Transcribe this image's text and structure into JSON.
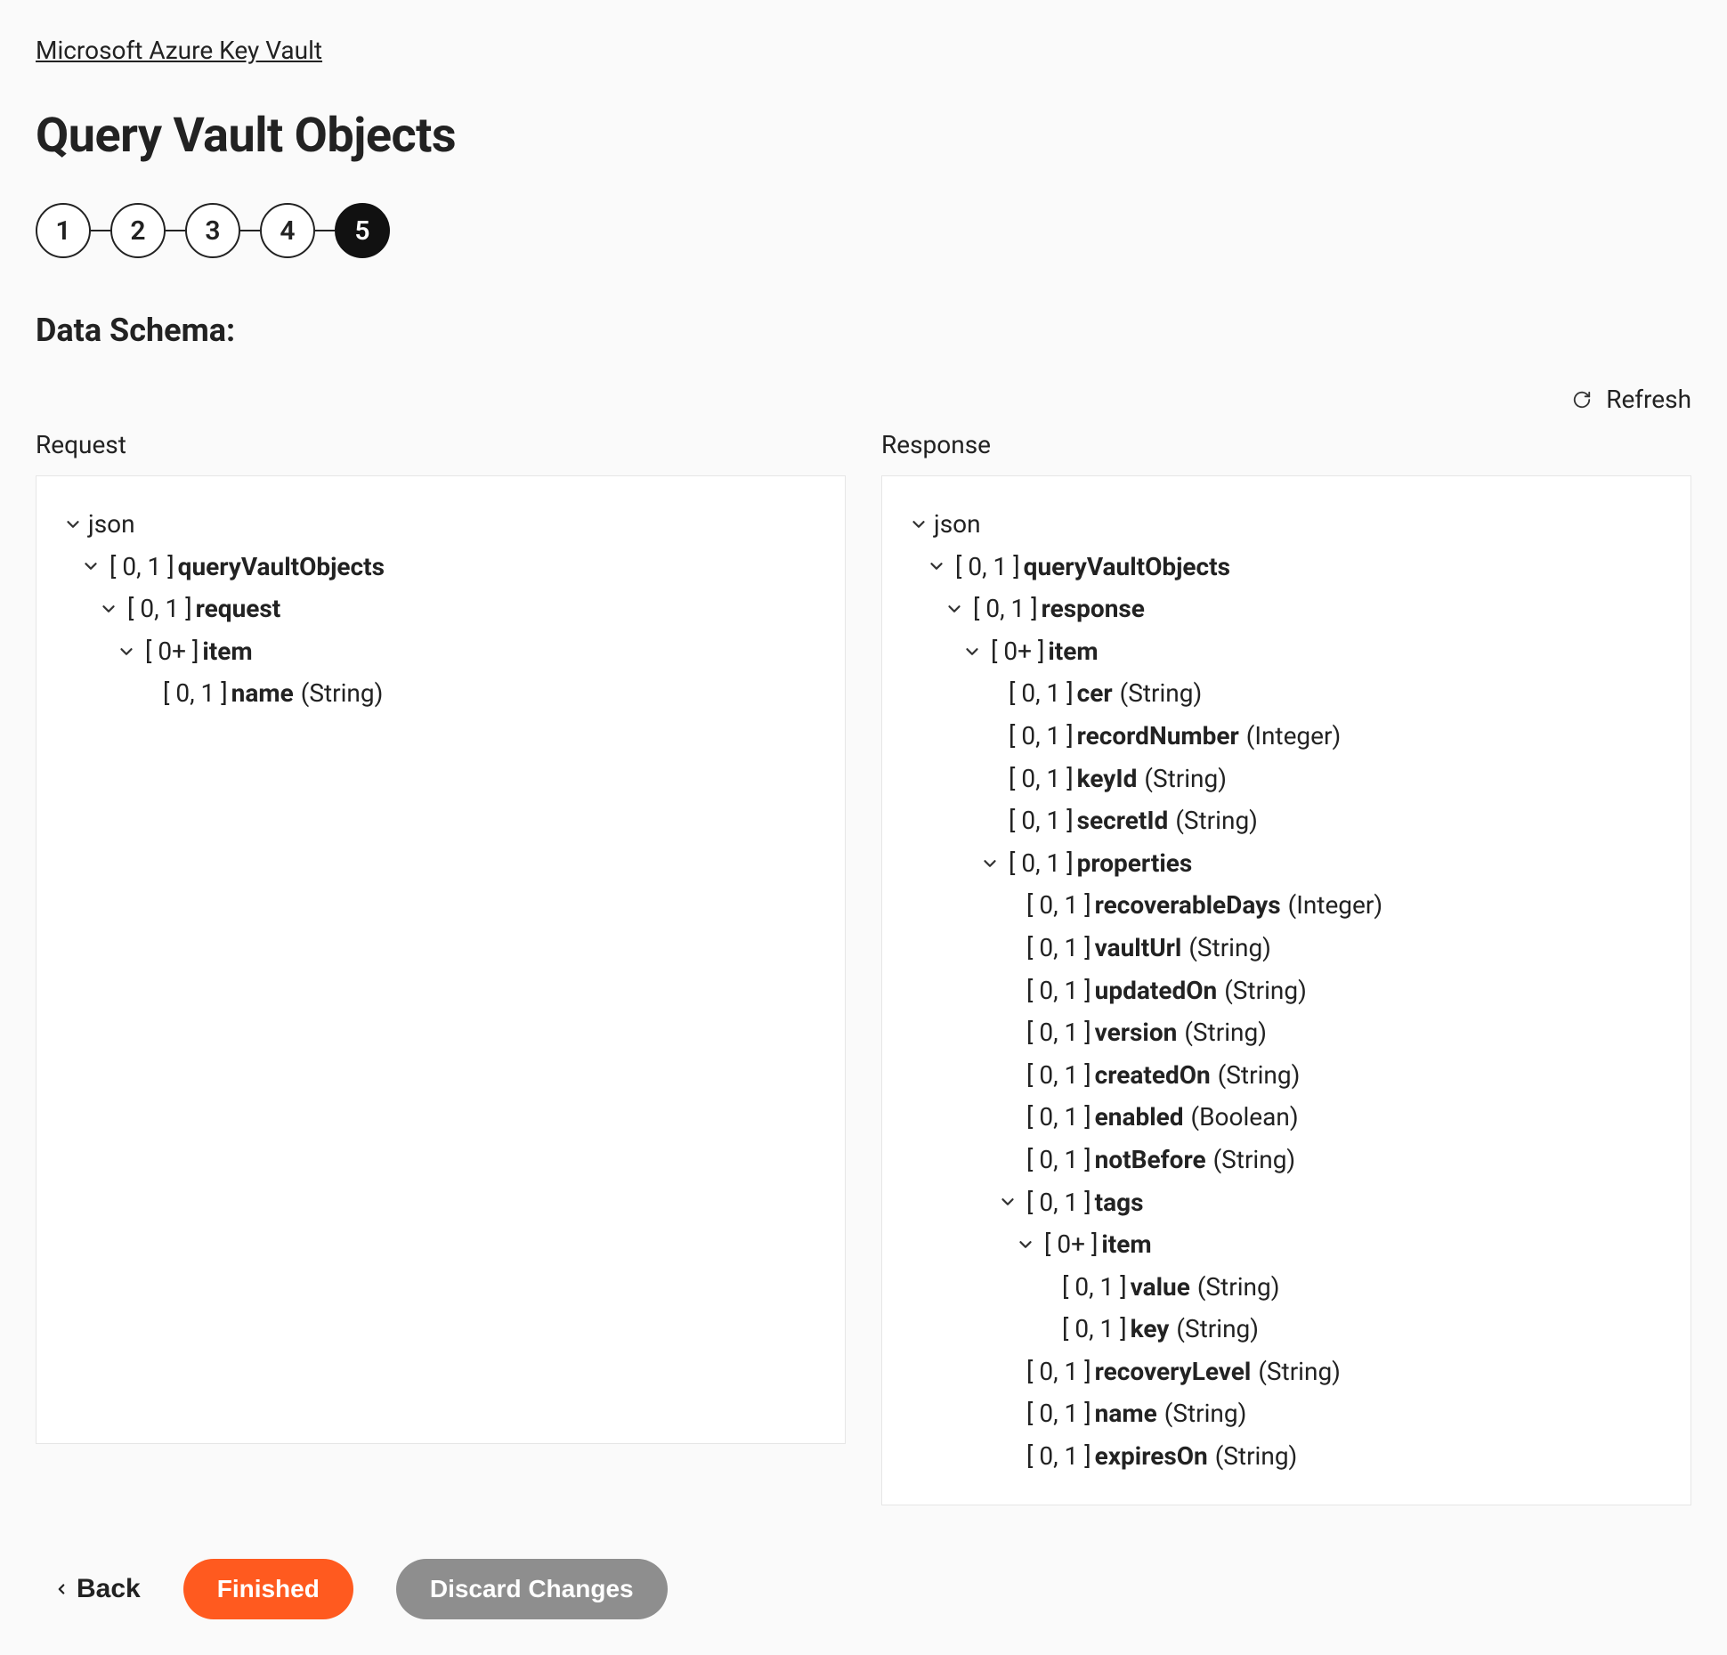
{
  "breadcrumb": {
    "text": "Microsoft Azure Key Vault"
  },
  "page": {
    "title": "Query Vault Objects",
    "section_title": "Data Schema:"
  },
  "stepper": {
    "steps": [
      "1",
      "2",
      "3",
      "4",
      "5"
    ],
    "active_index": 4
  },
  "refresh": {
    "label": "Refresh"
  },
  "panels": {
    "request_label": "Request",
    "response_label": "Response"
  },
  "request_tree": [
    {
      "depth": 0,
      "chevron": true,
      "label": "json"
    },
    {
      "depth": 1,
      "chevron": true,
      "card": "[ 0, 1 ]",
      "bold": "queryVaultObjects"
    },
    {
      "depth": 2,
      "chevron": true,
      "card": "[ 0, 1 ]",
      "bold": "request"
    },
    {
      "depth": 3,
      "chevron": true,
      "card": "[ 0+ ]",
      "bold": "item"
    },
    {
      "depth": 4,
      "chevron": false,
      "card": "[ 0, 1 ]",
      "bold": "name",
      "type": "(String)"
    }
  ],
  "response_tree": [
    {
      "depth": 0,
      "chevron": true,
      "label": "json"
    },
    {
      "depth": 1,
      "chevron": true,
      "card": "[ 0, 1 ]",
      "bold": "queryVaultObjects"
    },
    {
      "depth": 2,
      "chevron": true,
      "card": "[ 0, 1 ]",
      "bold": "response"
    },
    {
      "depth": 3,
      "chevron": true,
      "card": "[ 0+ ]",
      "bold": "item"
    },
    {
      "depth": 4,
      "chevron": false,
      "card": "[ 0, 1 ]",
      "bold": "cer",
      "type": "(String)"
    },
    {
      "depth": 4,
      "chevron": false,
      "card": "[ 0, 1 ]",
      "bold": "recordNumber",
      "type": "(Integer)"
    },
    {
      "depth": 4,
      "chevron": false,
      "card": "[ 0, 1 ]",
      "bold": "keyId",
      "type": "(String)"
    },
    {
      "depth": 4,
      "chevron": false,
      "card": "[ 0, 1 ]",
      "bold": "secretId",
      "type": "(String)"
    },
    {
      "depth": 4,
      "chevron": true,
      "card": "[ 0, 1 ]",
      "bold": "properties"
    },
    {
      "depth": 5,
      "chevron": false,
      "card": "[ 0, 1 ]",
      "bold": "recoverableDays",
      "type": "(Integer)"
    },
    {
      "depth": 5,
      "chevron": false,
      "card": "[ 0, 1 ]",
      "bold": "vaultUrl",
      "type": "(String)"
    },
    {
      "depth": 5,
      "chevron": false,
      "card": "[ 0, 1 ]",
      "bold": "updatedOn",
      "type": "(String)"
    },
    {
      "depth": 5,
      "chevron": false,
      "card": "[ 0, 1 ]",
      "bold": "version",
      "type": "(String)"
    },
    {
      "depth": 5,
      "chevron": false,
      "card": "[ 0, 1 ]",
      "bold": "createdOn",
      "type": "(String)"
    },
    {
      "depth": 5,
      "chevron": false,
      "card": "[ 0, 1 ]",
      "bold": "enabled",
      "type": "(Boolean)"
    },
    {
      "depth": 5,
      "chevron": false,
      "card": "[ 0, 1 ]",
      "bold": "notBefore",
      "type": "(String)"
    },
    {
      "depth": 5,
      "chevron": true,
      "card": "[ 0, 1 ]",
      "bold": "tags"
    },
    {
      "depth": 6,
      "chevron": true,
      "card": "[ 0+ ]",
      "bold": "item"
    },
    {
      "depth": 7,
      "chevron": false,
      "card": "[ 0, 1 ]",
      "bold": "value",
      "type": "(String)"
    },
    {
      "depth": 7,
      "chevron": false,
      "card": "[ 0, 1 ]",
      "bold": "key",
      "type": "(String)"
    },
    {
      "depth": 5,
      "chevron": false,
      "card": "[ 0, 1 ]",
      "bold": "recoveryLevel",
      "type": "(String)"
    },
    {
      "depth": 5,
      "chevron": false,
      "card": "[ 0, 1 ]",
      "bold": "name",
      "type": "(String)"
    },
    {
      "depth": 5,
      "chevron": false,
      "card": "[ 0, 1 ]",
      "bold": "expiresOn",
      "type": "(String)"
    }
  ],
  "buttons": {
    "back": "Back",
    "finished": "Finished",
    "discard": "Discard Changes"
  }
}
